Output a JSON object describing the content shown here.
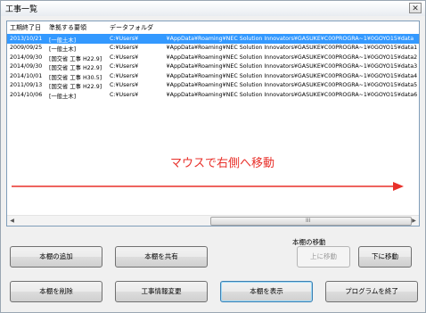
{
  "window": {
    "title": "工事一覧",
    "close_glyph": "✕"
  },
  "list": {
    "columns": [
      "工期終了日",
      "準拠する要領",
      "データフォルダ"
    ],
    "rows": [
      {
        "date": "2013/10/21",
        "standard": "[一般土木]",
        "folder": "C:¥Users¥     ¥AppData¥Roaming¥NEC Solution Innovators¥GASUKE¥C00PROGRA~1¥0GOYO15¥data"
      },
      {
        "date": "2009/09/25",
        "standard": "[一般土木]",
        "folder": "C:¥Users¥     ¥AppData¥Roaming¥NEC Solution Innovators¥GASUKE¥C00PROGRA~1¥0GOYO15¥data1"
      },
      {
        "date": "2014/09/30",
        "standard": "[国交省 工事 H22.9]",
        "folder": "C:¥Users¥     ¥AppData¥Roaming¥NEC Solution Innovators¥GASUKE¥C00PROGRA~1¥0GOYO15¥data2"
      },
      {
        "date": "2014/09/30",
        "standard": "[国交省 工事 H22.9]",
        "folder": "C:¥Users¥     ¥AppData¥Roaming¥NEC Solution Innovators¥GASUKE¥C00PROGRA~1¥0GOYO15¥data3"
      },
      {
        "date": "2014/10/01",
        "standard": "[国交省 工事 H30.5]",
        "folder": "C:¥Users¥     ¥AppData¥Roaming¥NEC Solution Innovators¥GASUKE¥C00PROGRA~1¥0GOYO15¥data4"
      },
      {
        "date": "2011/09/13",
        "standard": "[国交省 工事 H22.9]",
        "folder": "C:¥Users¥     ¥AppData¥Roaming¥NEC Solution Innovators¥GASUKE¥C00PROGRA~1¥0GOYO15¥data5"
      },
      {
        "date": "2014/10/06",
        "standard": "[一般土木]",
        "folder": "C:¥Users¥     ¥AppData¥Roaming¥NEC Solution Innovators¥GASUKE¥C00PROGRA~1¥0GOYO15¥data6"
      }
    ],
    "selected_row_index": 0,
    "scroll": {
      "left_glyph": "◀",
      "right_glyph": "▶",
      "grip": "III"
    }
  },
  "annotation": {
    "text": "マウスで右側へ移動",
    "color": "#e8302a"
  },
  "buttons": {
    "add": "本棚の追加",
    "share": "本棚を共有",
    "move_group_label": "本棚の移動",
    "move_up": "上に移動",
    "move_down": "下に移動",
    "delete": "本棚を削除",
    "change_info": "工事情報変更",
    "show": "本棚を表示",
    "exit": "プログラムを終了"
  }
}
